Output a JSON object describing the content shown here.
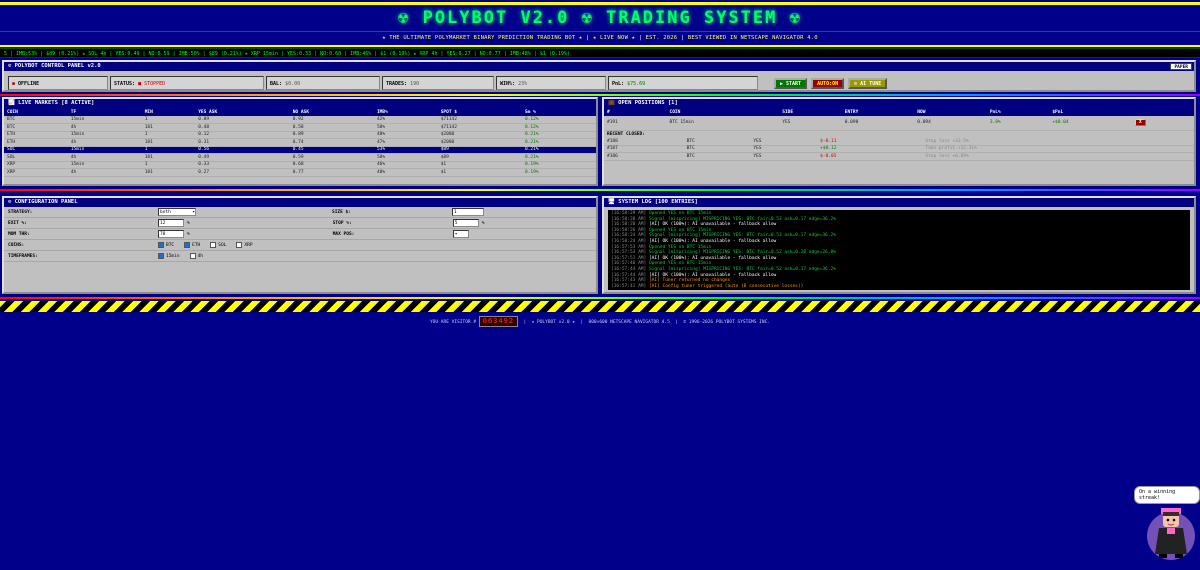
{
  "header": {
    "title": "☢ POLYBOT V2.0 ☢ TRADING SYSTEM ☢",
    "tagline_a": "★ THE ULTIMATE POLYMARKET BINARY PREDICTION TRADING BOT ★",
    "tagline_b": "★ LIVE NOW ★",
    "tagline_c": "EST. 2026",
    "tagline_d": "BEST VIEWED IN NETSCAPE NAVIGATOR 4.0"
  },
  "ticker": "5 | IMB:53% | $89 (0.21%)     ★ SOL 4h | YES:0.49 | NO:0.59 | IMB:50% | $89 (0.21%)     ★ XRP 15min | YES:0.33 | NO:0.68 | IMB:46% | $1 (0.19%)     ★ XRP 4h | YES:0.27 | NO:0.77 | IMB:48% | $1 (0.19%)",
  "control": {
    "title": "⚙ POLYBOT CONTROL PANEL v2.0",
    "paper_label": "PAPER",
    "mode_label": "OFFLINE",
    "status_label": "STATUS:",
    "status_value": "■ STOPPED",
    "bal_label": "BAL:",
    "bal_value": "$0.00",
    "trades_label": "TRADES:",
    "trades_value": "190",
    "win_label": "WIN%:",
    "win_value": "23%",
    "pnl_label": "PnL:",
    "pnl_value": "$75.69",
    "start_label": "▶ START",
    "auto_label": "AUTO:ON",
    "aitune_label": "⚙ AI TUNE"
  },
  "markets": {
    "title": "📈 LIVE MARKETS [8 ACTIVE]",
    "headers": [
      "COIN",
      "TF",
      "MIN",
      "YES ASK",
      "NO ASK",
      "IMB%",
      "SPOT $",
      "5m %"
    ],
    "rows": [
      [
        "BTC",
        "15min",
        "1",
        "0.09",
        "0.92",
        "42%",
        "$71142",
        "0.12%"
      ],
      [
        "BTC",
        "4h",
        "181",
        "0.48",
        "0.58",
        "50%",
        "$71142",
        "0.12%"
      ],
      [
        "ETH",
        "15min",
        "1",
        "0.12",
        "0.89",
        "40%",
        "$2080",
        "0.21%"
      ],
      [
        "ETH",
        "4h",
        "181",
        "0.31",
        "0.74",
        "47%",
        "$2080",
        "0.21%"
      ],
      [
        "SOL",
        "15min",
        "1",
        "0.56",
        "0.45",
        "53%",
        "$89",
        "0.21%"
      ],
      [
        "SOL",
        "4h",
        "181",
        "0.49",
        "0.59",
        "50%",
        "$89",
        "0.21%"
      ],
      [
        "XRP",
        "15min",
        "1",
        "0.33",
        "0.68",
        "46%",
        "$1",
        "0.19%"
      ],
      [
        "XRP",
        "4h",
        "181",
        "0.27",
        "0.77",
        "48%",
        "$1",
        "0.19%"
      ]
    ],
    "selected_index": 4
  },
  "positions": {
    "title": "💼 OPEN POSITIONS [1]",
    "headers": [
      "#",
      "COIN",
      "SIDE",
      "ENTRY",
      "NOW",
      "PnL%",
      "$PnL",
      ""
    ],
    "open": [
      [
        "#191",
        "BTC 15min",
        "YES",
        "0.090",
        "0.094",
        "3.8%",
        "+$0.04",
        "X"
      ]
    ],
    "recent_title": "RECENT CLOSED:",
    "closed": [
      [
        "#188",
        "BTC",
        "YES",
        "$-0.11",
        "Stop loss +33.5%"
      ],
      [
        "#187",
        "BTC",
        "YES",
        "+$0.12",
        "Take profit +12.31%"
      ],
      [
        "#186",
        "BTC",
        "YES",
        "$-0.05",
        "Stop loss +0.09%"
      ]
    ]
  },
  "config": {
    "title": "⚙ CONFIGURATION PANEL",
    "strategy_label": "STRATEGY:",
    "strategy_value": "both",
    "size_label": "SIZE $:",
    "size_value": "1",
    "exit_label": "EXIT %:",
    "exit_value": "12",
    "stop_label": "STOP %:",
    "stop_value": "5",
    "pct": "%",
    "mom_label": "MOM THR:",
    "mom_value": "78",
    "maxpos_label": "MAX POS:",
    "coins_label": "COINS:",
    "coins": [
      {
        "name": "BTC",
        "on": true
      },
      {
        "name": "ETH",
        "on": true
      },
      {
        "name": "SOL",
        "on": false
      },
      {
        "name": "XRP",
        "on": false
      }
    ],
    "tf_label": "TIMEFRAMES:",
    "timeframes": [
      {
        "name": "15min",
        "on": true
      },
      {
        "name": "4h",
        "on": false
      }
    ]
  },
  "log": {
    "title": "🖥 SYSTEM LOG [100 ENTRIES]",
    "entries": [
      {
        "t": "16:58:29 AM]",
        "m": "Opened YES on BTC 15min",
        "c": "lg"
      },
      {
        "t": "16:58:28 AM]",
        "m": "Signal [mispricing] MISPRICING YES: BTC fair=0.53 ask=0.17 edge=36.2%",
        "c": "lg"
      },
      {
        "t": "16:58:28 AM]",
        "m": "[AI] OK (100%): AI unavailable - fallback allow",
        "c": "lw"
      },
      {
        "t": "16:58:26 AM]",
        "m": "Opened YES on BTC 15min",
        "c": "lg"
      },
      {
        "t": "16:58:24 AM]",
        "m": "Signal [mispricing] MISPRICING YES: BTC fair=0.53 ask=0.17 edge=36.2%",
        "c": "lg"
      },
      {
        "t": "16:58:24 AM]",
        "m": "[AI] OK (100%): AI unavailable - fallback allow",
        "c": "lw"
      },
      {
        "t": "16:57:53 AM]",
        "m": "Opened YES on BTC 15min",
        "c": "lg"
      },
      {
        "t": "16:57:53 AM]",
        "m": "Signal [mispricing] MISPRICING YES: BTC fair=0.52 ask=0.28 edge=26.8%",
        "c": "lg"
      },
      {
        "t": "16:57:51 AM]",
        "m": "[AI] OK (100%): AI unavailable - fallback allow",
        "c": "lw"
      },
      {
        "t": "16:57:46 AM]",
        "m": "Opened YES on BTC 15min",
        "c": "lg"
      },
      {
        "t": "16:57:44 AM]",
        "m": "Signal [mispricing] MISPRICING YES: BTC fair=0.52 ask=0.17 edge=36.2%",
        "c": "lg"
      },
      {
        "t": "16:57:44 AM]",
        "m": "[AI] OK (100%): AI unavailable - fallback allow",
        "c": "lw"
      },
      {
        "t": "16:57:43 AM]",
        "m": "[AI] Tuner returned no changes",
        "c": "lo"
      },
      {
        "t": "16:57:41 AM]",
        "m": "[AI] Config tuner triggered (auto (8 consecutive losses))",
        "c": "lo"
      }
    ]
  },
  "footer": {
    "visitor_label": "YOU ARE VISITOR #",
    "visitor_count": "063492",
    "text_a": "★ POLYBOT v2.0 ★",
    "text_b": "800×600 NETSCAPE NAVIGATOR 4.5",
    "text_c": "© 1996-2026 POLYBOT SYSTEMS INC."
  },
  "mascot": {
    "speech": "On a winning streak!"
  }
}
